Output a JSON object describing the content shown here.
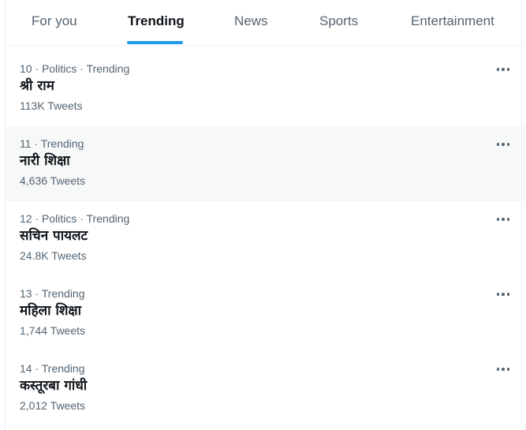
{
  "tabs": [
    {
      "label": "For you",
      "active": false
    },
    {
      "label": "Trending",
      "active": true
    },
    {
      "label": "News",
      "active": false
    },
    {
      "label": "Sports",
      "active": false
    },
    {
      "label": "Entertainment",
      "active": false
    }
  ],
  "colors": {
    "accent": "#1d9bf0",
    "text_primary": "#0f1419",
    "text_secondary": "#536471",
    "hover_bg": "#f7f9f9",
    "border": "#eff3f4"
  },
  "trends": [
    {
      "meta": "10 · Politics · Trending",
      "name": "श्री राम",
      "count": "113K Tweets",
      "more_icon": "more-horizontal-icon"
    },
    {
      "meta": "11 · Trending",
      "name": "नारी शिक्षा",
      "count": "4,636 Tweets",
      "more_icon": "more-horizontal-icon"
    },
    {
      "meta": "12 · Politics · Trending",
      "name": "सचिन पायलट",
      "count": "24.8K Tweets",
      "more_icon": "more-horizontal-icon"
    },
    {
      "meta": "13 · Trending",
      "name": "महिला शिक्षा",
      "count": "1,744 Tweets",
      "more_icon": "more-horizontal-icon"
    },
    {
      "meta": "14 · Trending",
      "name": "कस्तूरबा गांधी",
      "count": "2,012 Tweets",
      "more_icon": "more-horizontal-icon"
    }
  ]
}
